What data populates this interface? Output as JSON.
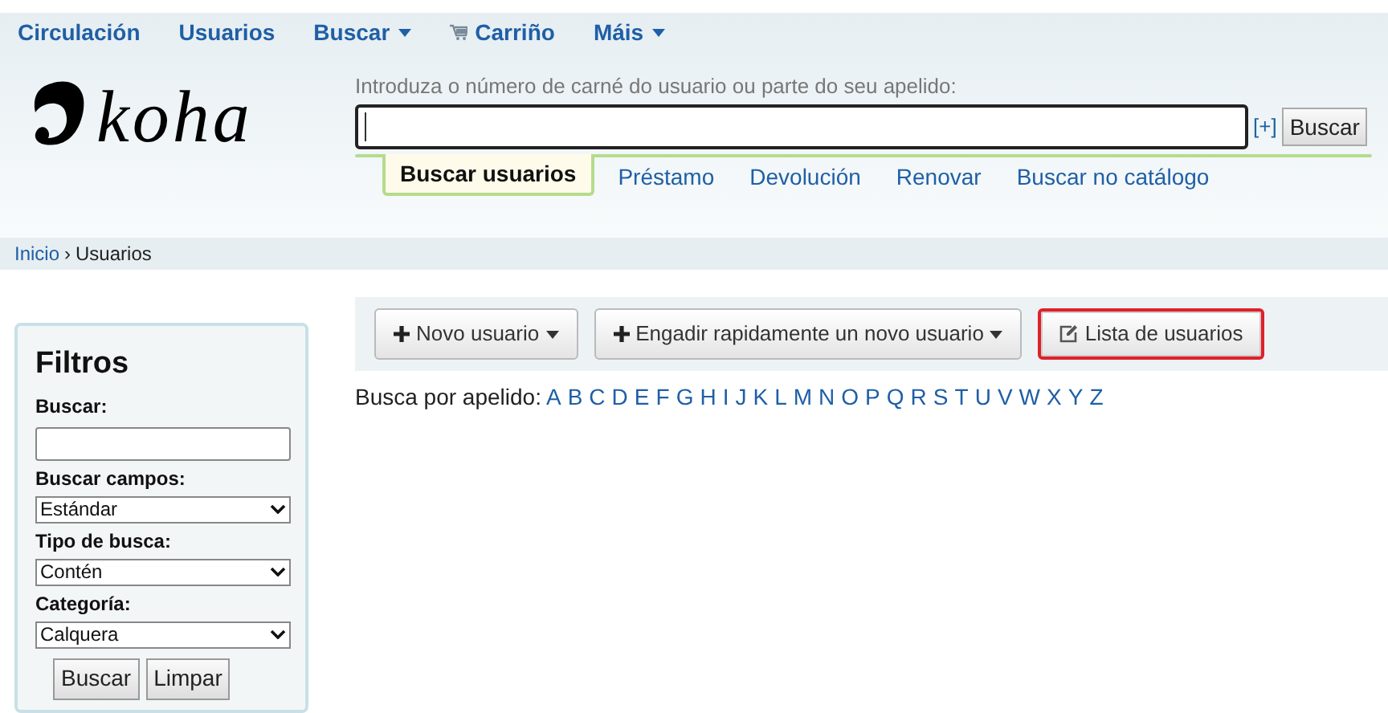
{
  "nav": [
    {
      "label": "Circulación",
      "dropdown": false,
      "kind": "plain"
    },
    {
      "label": "Usuarios",
      "dropdown": false,
      "kind": "plain"
    },
    {
      "label": "Buscar",
      "dropdown": true,
      "kind": "plain"
    },
    {
      "label": "Carriño",
      "dropdown": false,
      "kind": "cart"
    },
    {
      "label": "Máis",
      "dropdown": true,
      "kind": "plain"
    }
  ],
  "logo": "koha",
  "search": {
    "label": "Introduza o número de carné do usuario ou parte do seu apelido:",
    "expand": "[+]",
    "button": "Buscar"
  },
  "search_tabs": [
    {
      "label": "Buscar usuarios",
      "selected": true
    },
    {
      "label": "Préstamo",
      "selected": false
    },
    {
      "label": "Devolución",
      "selected": false
    },
    {
      "label": "Renovar",
      "selected": false
    },
    {
      "label": "Buscar no catálogo",
      "selected": false
    }
  ],
  "breadcrumb": [
    {
      "label": "Inicio",
      "link": true
    },
    {
      "label": "Usuarios",
      "link": false
    }
  ],
  "breadcrumb_separator": "›",
  "filters": {
    "title": "Filtros",
    "fields": [
      {
        "kind": "text",
        "label": "Buscar:"
      },
      {
        "kind": "select",
        "label": "Buscar campos:",
        "value": "Estándar"
      },
      {
        "kind": "select",
        "label": "Tipo de busca:",
        "value": "Contén"
      },
      {
        "kind": "select",
        "label": "Categoría:",
        "value": "Calquera"
      }
    ],
    "buttons": [
      "Buscar",
      "Limpar"
    ]
  },
  "toolbar": [
    {
      "label": "Novo usuario",
      "kind": "add",
      "dropdown": true,
      "highlighted": false
    },
    {
      "label": "Engadir rapidamente un novo usuario",
      "kind": "add",
      "dropdown": true,
      "highlighted": false
    },
    {
      "label": "Lista de usuarios",
      "kind": "edit",
      "dropdown": false,
      "highlighted": true
    }
  ],
  "letters": {
    "label": "Busca por apelido:",
    "items": [
      "A",
      "B",
      "C",
      "D",
      "E",
      "F",
      "G",
      "H",
      "I",
      "J",
      "K",
      "L",
      "M",
      "N",
      "O",
      "P",
      "Q",
      "R",
      "S",
      "T",
      "U",
      "V",
      "W",
      "X",
      "Y",
      "Z"
    ]
  }
}
